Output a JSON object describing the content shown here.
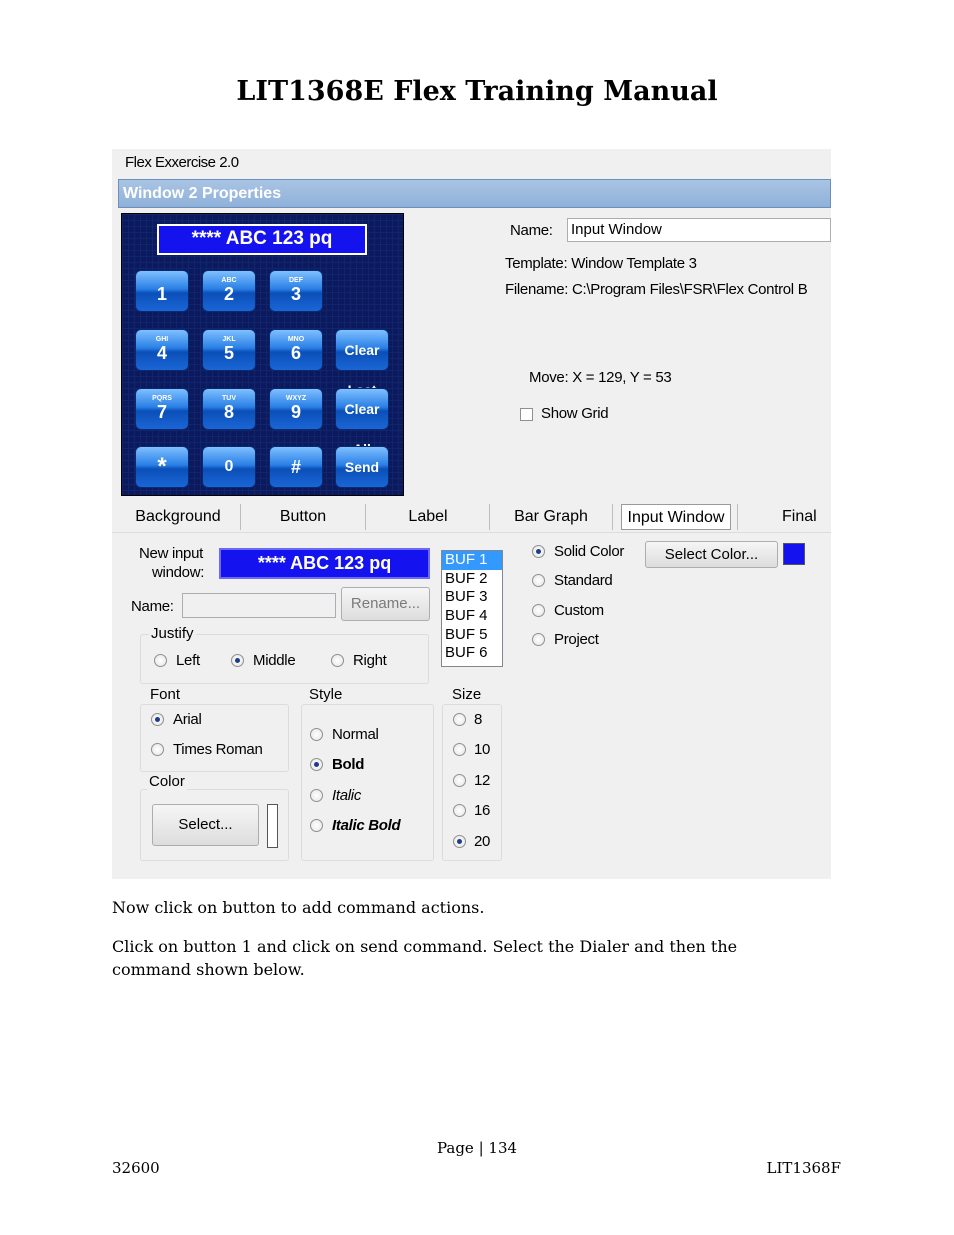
{
  "document": {
    "title": "LIT1368E Flex Training Manual",
    "paragraph1": "Now click on button to add command actions.",
    "paragraph2": "Click on button 1 and click on send command. Select the Dialer and then the command shown below.",
    "page": "Page | 134",
    "footer_left": "32600",
    "footer_right": "LIT1368F"
  },
  "app": {
    "title": "Flex Exxercise 2.0",
    "properties_header": "Window 2 Properties",
    "keypad": {
      "display": "**** ABC 123 pq",
      "buttons": [
        {
          "sub": "",
          "main": "1"
        },
        {
          "sub": "ABC",
          "main": "2"
        },
        {
          "sub": "DEF",
          "main": "3"
        },
        {
          "sub": "GHI",
          "main": "4"
        },
        {
          "sub": "JKL",
          "main": "5"
        },
        {
          "sub": "MNO",
          "main": "6"
        },
        {
          "sub": "",
          "main": "Clear Last"
        },
        {
          "sub": "PQRS",
          "main": "7"
        },
        {
          "sub": "TUV",
          "main": "8"
        },
        {
          "sub": "WXYZ",
          "main": "9"
        },
        {
          "sub": "",
          "main": "Clear All"
        },
        {
          "sub": "",
          "main": "*"
        },
        {
          "sub": "",
          "main": "0"
        },
        {
          "sub": "",
          "main": "#"
        },
        {
          "sub": "",
          "main": "Send"
        }
      ]
    },
    "props": {
      "name_label": "Name:",
      "name_value": "Input Window",
      "template": "Template: Window Template 3",
      "filename": "Filename: C:\\Program Files\\FSR\\Flex Control B",
      "move": "Move: X = 129, Y = 53",
      "show_grid": "Show Grid",
      "show_grid_checked": false
    },
    "tabs": [
      "Background",
      "Button",
      "Label",
      "Bar Graph",
      "Input Window",
      "Final"
    ],
    "active_tab": "Input Window",
    "input_window": {
      "new_input_label_1": "New input",
      "new_input_label_2": "window:",
      "preview_text": "**** ABC 123 pq",
      "name_label": "Name:",
      "name_value": "",
      "rename_button": "Rename...",
      "buffers": [
        "BUF 1",
        "BUF 2",
        "BUF 3",
        "BUF 4",
        "BUF 5",
        "BUF 6"
      ],
      "selected_buffer": "BUF 1",
      "color_options": [
        "Solid Color",
        "Standard",
        "Custom",
        "Project"
      ],
      "selected_color_option": "Solid Color",
      "select_color_button": "Select Color...",
      "swatch_color": "#1412ef",
      "justify": {
        "title": "Justify",
        "options": [
          "Left",
          "Middle",
          "Right"
        ],
        "selected": "Middle"
      },
      "font": {
        "title": "Font",
        "options": [
          "Arial",
          "Times Roman"
        ],
        "selected": "Arial"
      },
      "style": {
        "title": "Style",
        "options": [
          "Normal",
          "Bold",
          "Italic",
          "Italic Bold"
        ],
        "selected": "Bold"
      },
      "size": {
        "title": "Size",
        "options": [
          "8",
          "10",
          "12",
          "16",
          "20"
        ],
        "selected": "20"
      },
      "color": {
        "title": "Color",
        "select_button": "Select..."
      }
    }
  }
}
